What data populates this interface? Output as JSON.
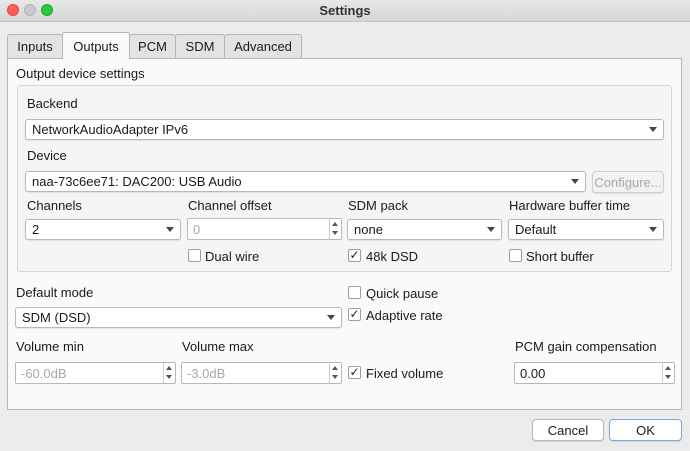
{
  "window": {
    "title": "Settings"
  },
  "tabs": [
    {
      "label": "Inputs"
    },
    {
      "label": "Outputs"
    },
    {
      "label": "PCM"
    },
    {
      "label": "SDM"
    },
    {
      "label": "Advanced"
    }
  ],
  "active_tab": "Outputs",
  "output_group": {
    "title": "Output device settings",
    "backend": {
      "label": "Backend",
      "value": "NetworkAudioAdapter IPv6"
    },
    "device": {
      "label": "Device",
      "value": "naa-73c6ee71: DAC200: USB Audio",
      "configure_label": "Configure..."
    },
    "channels": {
      "label": "Channels",
      "value": "2"
    },
    "channel_offset": {
      "label": "Channel offset",
      "value": "0"
    },
    "sdm_pack": {
      "label": "SDM pack",
      "value": "none"
    },
    "hw_buffer": {
      "label": "Hardware buffer time",
      "value": "Default"
    },
    "dual_wire": {
      "label": "Dual wire",
      "checked": false
    },
    "dsd48k": {
      "label": "48k DSD",
      "checked": true
    },
    "short_buffer": {
      "label": "Short buffer",
      "checked": false
    }
  },
  "default_mode": {
    "label": "Default mode",
    "value": "SDM (DSD)"
  },
  "quick_pause": {
    "label": "Quick pause",
    "checked": false
  },
  "adaptive_rate": {
    "label": "Adaptive rate",
    "checked": true
  },
  "volume_min": {
    "label": "Volume min",
    "value": "-60.0dB"
  },
  "volume_max": {
    "label": "Volume max",
    "value": "-3.0dB"
  },
  "fixed_volume": {
    "label": "Fixed volume",
    "checked": true
  },
  "pcm_gain": {
    "label": "PCM gain compensation",
    "value": "0.00"
  },
  "footer": {
    "cancel_label": "Cancel",
    "ok_label": "OK"
  },
  "checkmark_glyph": "✓"
}
